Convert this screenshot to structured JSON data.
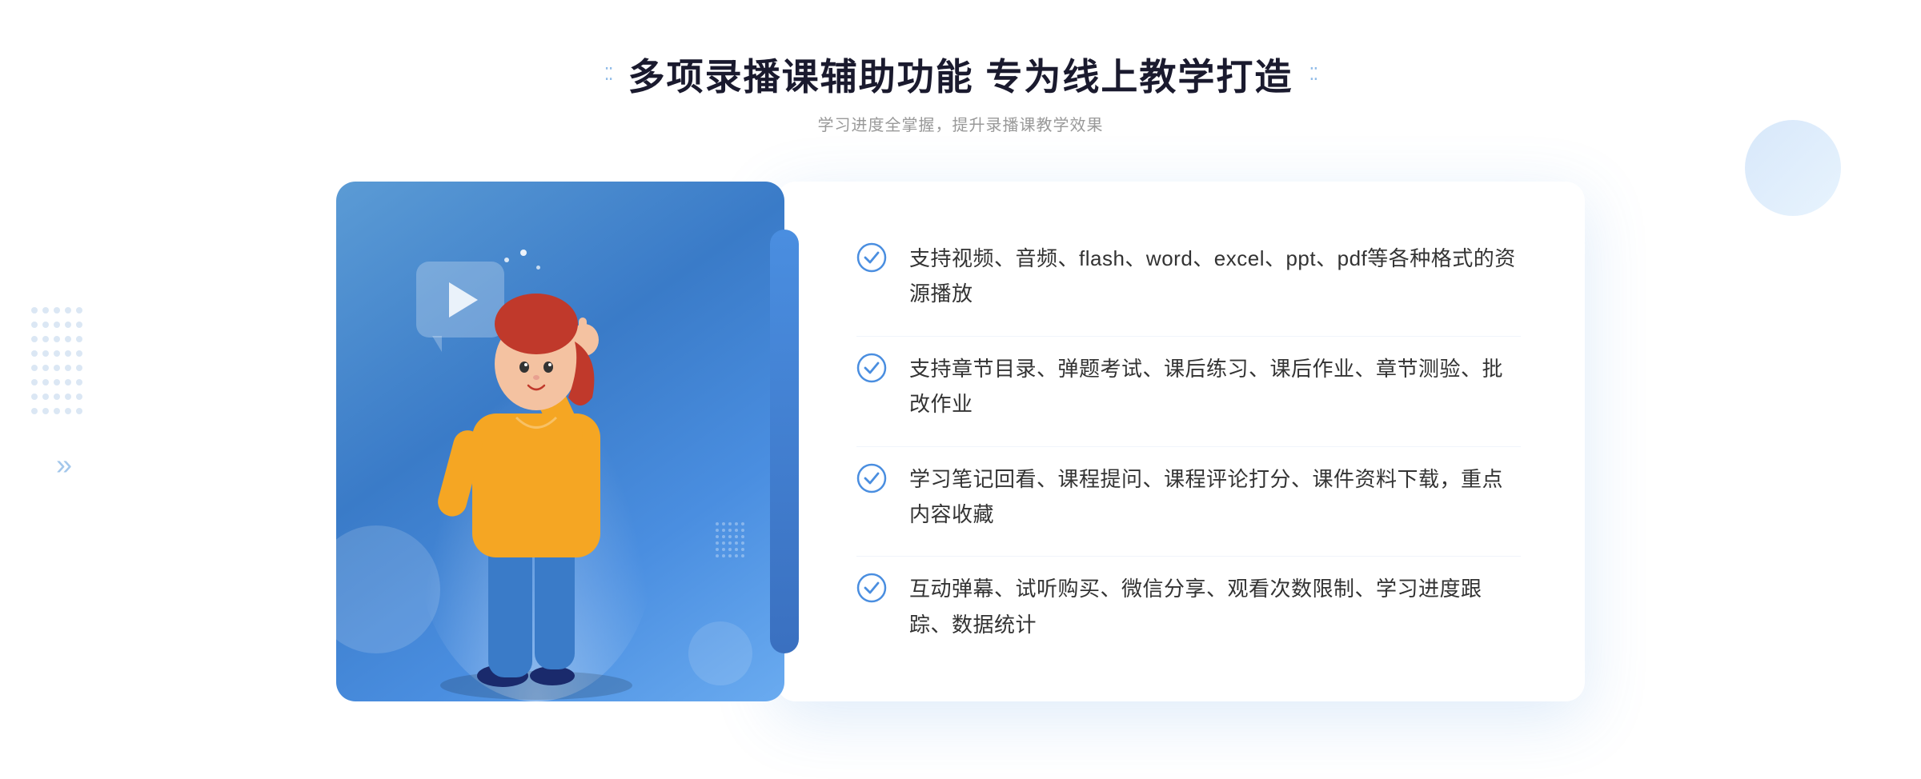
{
  "header": {
    "title": "多项录播课辅助功能 专为线上教学打造",
    "subtitle": "学习进度全掌握，提升录播课教学效果",
    "dots_left": "⁚⁚",
    "dots_right": "⁚⁚"
  },
  "features": [
    {
      "id": 1,
      "text": "支持视频、音频、flash、word、excel、ppt、pdf等各种格式的资源播放"
    },
    {
      "id": 2,
      "text": "支持章节目录、弹题考试、课后练习、课后作业、章节测验、批改作业"
    },
    {
      "id": 3,
      "text": "学习笔记回看、课程提问、课程评论打分、课件资料下载，重点内容收藏"
    },
    {
      "id": 4,
      "text": "互动弹幕、试听购买、微信分享、观看次数限制、学习进度跟踪、数据统计"
    }
  ],
  "chevron_left": "»",
  "colors": {
    "accent_blue": "#3a7bc8",
    "light_blue": "#6aabf0",
    "check_blue": "#4a8ee0"
  }
}
